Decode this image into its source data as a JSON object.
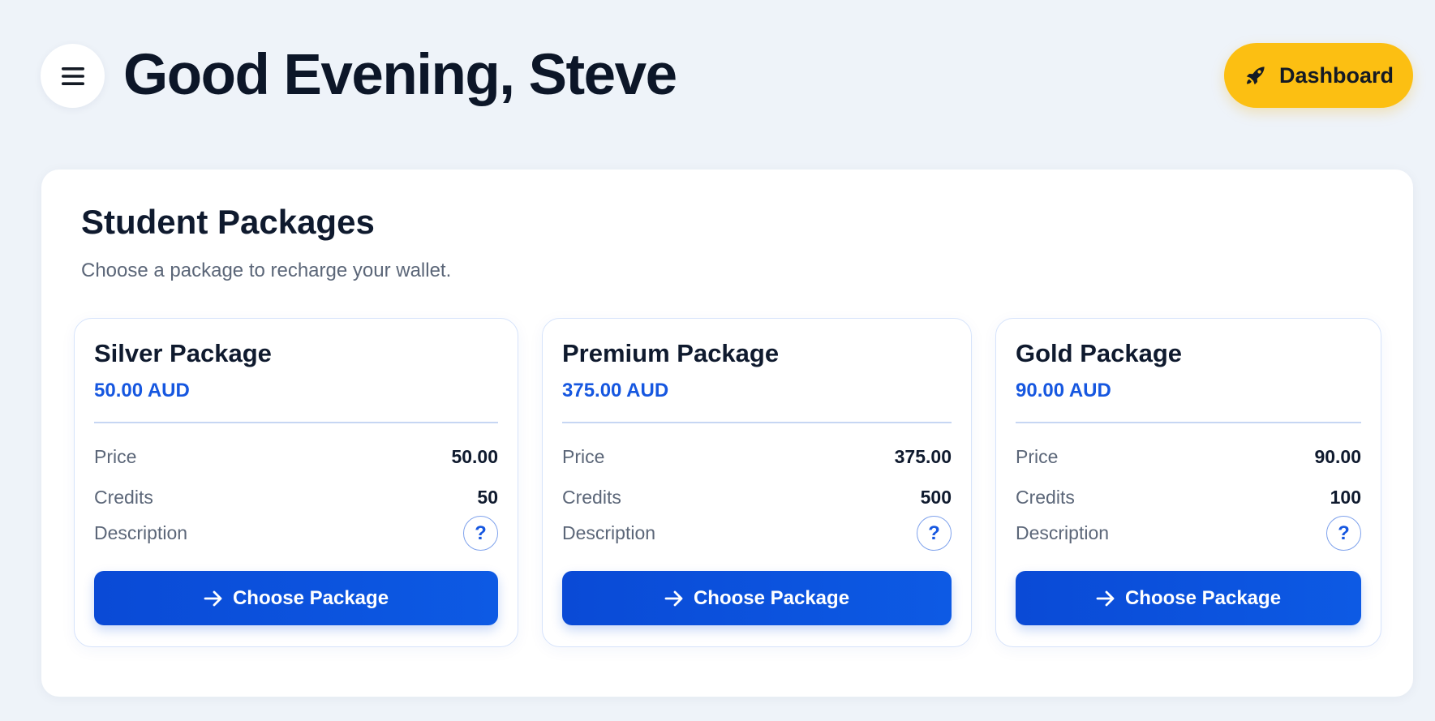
{
  "header": {
    "greeting": "Good Evening, Steve",
    "dashboard_label": "Dashboard"
  },
  "panel": {
    "title": "Student Packages",
    "subtitle": "Choose a package to recharge your wallet."
  },
  "labels": {
    "price": "Price",
    "credits": "Credits",
    "description": "Description",
    "help": "?",
    "choose": "Choose Package"
  },
  "packages": [
    {
      "name": "Silver Package",
      "amount": "50.00 AUD",
      "price": "50.00",
      "credits": "50"
    },
    {
      "name": "Premium Package",
      "amount": "375.00 AUD",
      "price": "375.00",
      "credits": "500"
    },
    {
      "name": "Gold Package",
      "amount": "90.00 AUD",
      "price": "90.00",
      "credits": "100"
    }
  ],
  "colors": {
    "background": "#eef3f9",
    "accent_blue": "#1657e0",
    "button_blue": "#0a4ad6",
    "dashboard_yellow": "#fcbf12"
  },
  "icons": {
    "menu": "hamburger-menu-icon",
    "dashboard": "rocket-icon",
    "choose": "arrow-right-icon",
    "help": "question-mark-icon"
  }
}
